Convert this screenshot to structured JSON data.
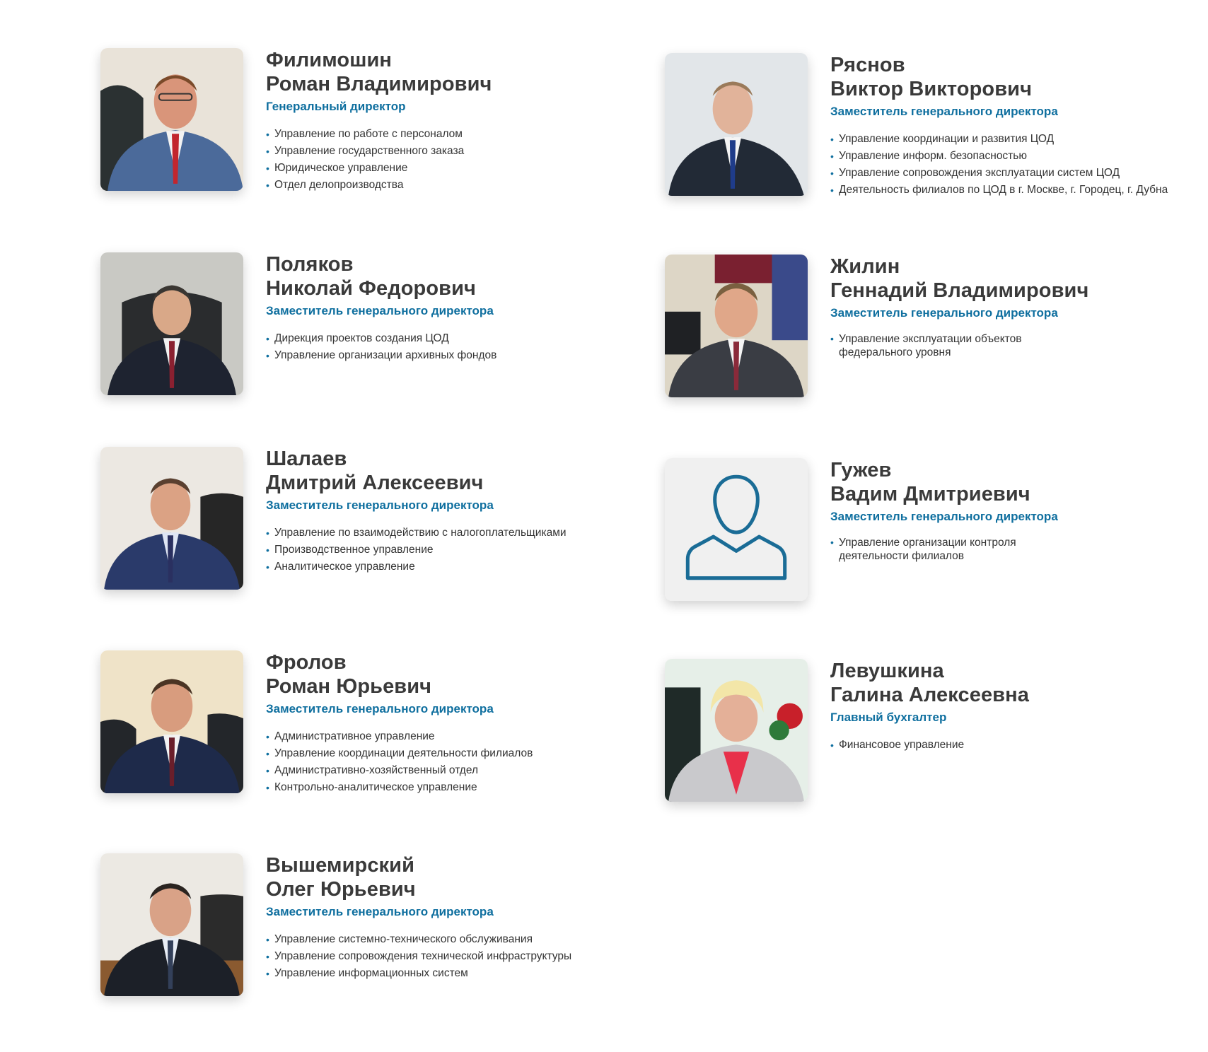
{
  "colors": {
    "accent": "#0f6f9f",
    "name": "#3a3a3a",
    "text": "#333333"
  },
  "people": [
    {
      "surname": "Филимошин",
      "given": "Роман Владимирович",
      "role": "Генеральный директор",
      "duties": [
        "Управление по работе с персоналом",
        "Управление государственного заказа",
        "Юридическое управление",
        "Отдел делопроизводства"
      ]
    },
    {
      "surname": "Ряснов",
      "given": "Виктор Викторович",
      "role": "Заместитель генерального директора",
      "duties": [
        "Управление координации и развития ЦОД",
        "Управление информ. безопасностью",
        "Управление сопровождения эксплуатации систем ЦОД",
        "Деятельность филиалов по ЦОД в г. Москве, г. Городец, г. Дубна"
      ]
    },
    {
      "surname": "Поляков",
      "given": "Николай Федорович",
      "role": "Заместитель генерального директора",
      "duties": [
        "Дирекция проектов создания ЦОД",
        "Управление организации архивных фондов"
      ]
    },
    {
      "surname": "Жилин",
      "given": "Геннадий Владимирович",
      "role": "Заместитель генерального директора",
      "duties": [
        "Управление эксплуатации объектов федерального уровня"
      ]
    },
    {
      "surname": "Шалаев",
      "given": "Дмитрий Алексеевич",
      "role": "Заместитель генерального директора",
      "duties": [
        "Управление по взаимодействию с налогоплательщиками",
        "Производственное управление",
        "Аналитическое управление"
      ]
    },
    {
      "surname": "Гужев",
      "given": "Вадим Дмитриевич",
      "role": "Заместитель генерального директора",
      "duties": [
        "Управление организации контроля деятельности филиалов"
      ]
    },
    {
      "surname": "Фролов",
      "given": "Роман Юрьевич",
      "role": "Заместитель генерального директора",
      "duties": [
        "Административное управление",
        "Управление координации деятельности филиалов",
        "Административно-хозяйственный отдел",
        "Контрольно-аналитическое управление"
      ]
    },
    {
      "surname": "Левушкина",
      "given": "Галина Алексеевна",
      "role": "Главный бухгалтер",
      "duties": [
        "Финансовое управление"
      ]
    },
    {
      "surname": "Вышемирский",
      "given": "Олег Юрьевич",
      "role": "Заместитель генерального директора",
      "duties": [
        "Управление системно-технического обслуживания",
        "Управление сопровождения технической инфраструктуры",
        "Управление информационных систем"
      ]
    }
  ]
}
